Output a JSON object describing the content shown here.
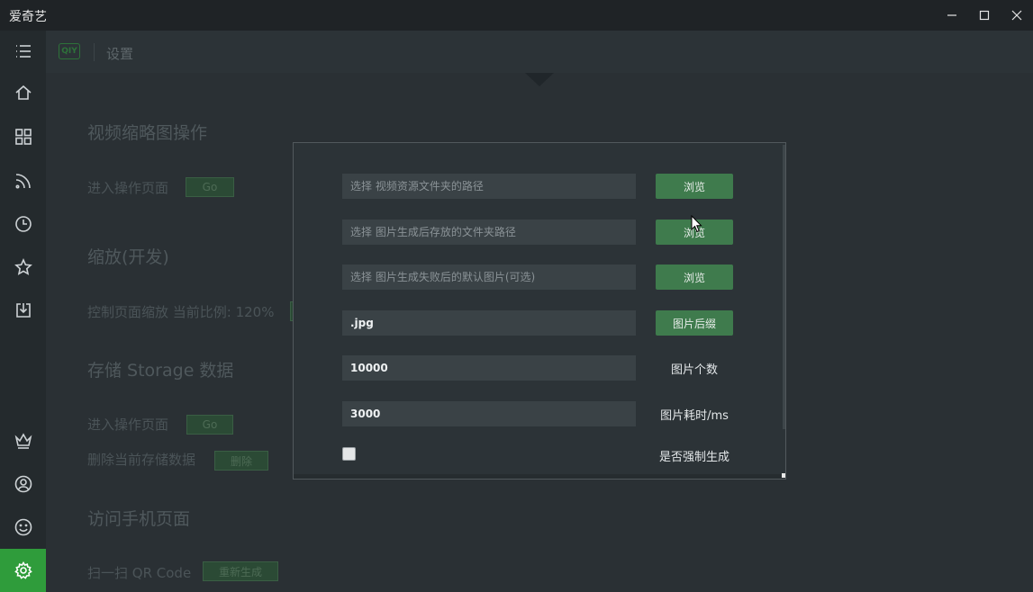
{
  "app": {
    "title": "爱奇艺"
  },
  "header": {
    "logo_text": "QIY",
    "breadcrumb": "设置"
  },
  "sidebar": {
    "items": [
      {
        "name": "menu",
        "icon": "menu-icon"
      },
      {
        "name": "home",
        "icon": "home-icon"
      },
      {
        "name": "apps",
        "icon": "grid-icon"
      },
      {
        "name": "feed",
        "icon": "rss-icon"
      },
      {
        "name": "history",
        "icon": "clock-icon"
      },
      {
        "name": "favorites",
        "icon": "star-icon"
      },
      {
        "name": "downloads",
        "icon": "download-icon"
      },
      {
        "name": "vip",
        "icon": "crown-icon"
      },
      {
        "name": "account",
        "icon": "user-icon"
      },
      {
        "name": "feedback",
        "icon": "smile-icon"
      },
      {
        "name": "settings",
        "icon": "gear-icon",
        "active": true
      }
    ]
  },
  "settings": {
    "thumb_section": "视频缩略图操作",
    "thumb_enter": "进入操作页面",
    "thumb_go": "Go",
    "zoom_section": "缩放(开发)",
    "zoom_label": "控制页面缩放 当前比例: 120%",
    "zoom_minus": "-",
    "zoom_plus": "+",
    "storage_section": "存储 Storage 数据",
    "storage_enter": "进入操作页面",
    "storage_go": "Go",
    "storage_delete_label": "删除当前存储数据",
    "storage_delete": "删除",
    "mobile_section": "访问手机页面",
    "qr_label": "扫一扫 QR Code",
    "qr_regen": "重新生成"
  },
  "dialog": {
    "video_path_placeholder": "选择 视频资源文件夹的路径",
    "output_path_placeholder": "选择 图片生成后存放的文件夹路径",
    "fallback_image_placeholder": "选择 图片生成失败后的默认图片(可选)",
    "browse_1": "浏览",
    "browse_2": "浏览",
    "browse_3": "浏览",
    "suffix_value": ".jpg",
    "suffix_button": "图片后缀",
    "count_value": "10000",
    "count_label": "图片个数",
    "time_value": "3000",
    "time_label": "图片耗时/ms",
    "force_checked": false,
    "force_label": "是否强制生成"
  },
  "colors": {
    "accent": "#2f9c3b",
    "button": "#3f7b4d",
    "background": "#2a3034"
  }
}
